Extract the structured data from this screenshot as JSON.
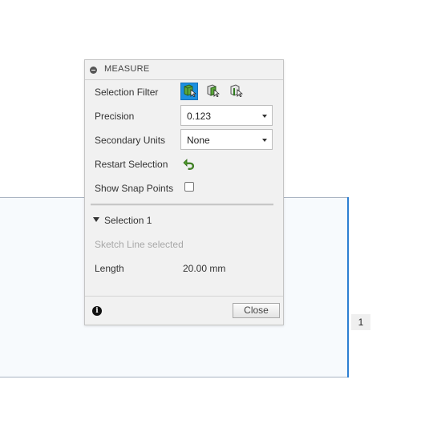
{
  "panel": {
    "title": "MEASURE",
    "selection_filter_label": "Selection Filter",
    "precision_label": "Precision",
    "precision_value": "0.123",
    "secondary_units_label": "Secondary Units",
    "secondary_units_value": "None",
    "restart_selection_label": "Restart Selection",
    "show_snap_points_label": "Show Snap Points",
    "show_snap_points_checked": false,
    "section_title": "Selection 1",
    "selected_text": "Sketch Line selected",
    "length_label": "Length",
    "length_value": "20.00 mm",
    "close_label": "Close",
    "filter_icons": [
      "select-body-icon",
      "select-face-icon",
      "select-edge-icon"
    ],
    "accent_color": "#1b8fe0"
  },
  "canvas": {
    "dimension_label": "1"
  }
}
